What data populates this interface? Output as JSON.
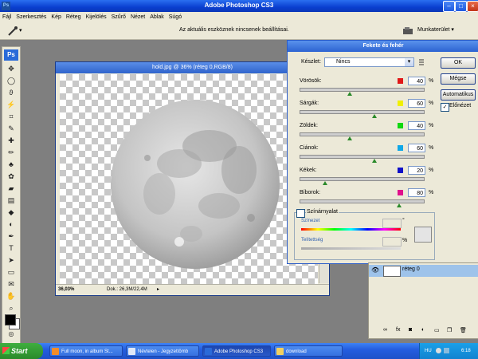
{
  "window": {
    "title": "Adobe Photoshop CS3",
    "minimize": "–",
    "maximize": "□",
    "close": "×"
  },
  "menu": [
    "Fájl",
    "Szerkesztés",
    "Kép",
    "Réteg",
    "Kijelölés",
    "Szűrő",
    "Nézet",
    "Ablak",
    "Súgó"
  ],
  "options": {
    "message": "Az aktuális eszköznek nincsenek beállításai.",
    "workspace_label": "Munkaterület ▾"
  },
  "toolbox": {
    "logo": "Ps"
  },
  "document": {
    "title": "hold.jpg @ 36% (réteg 0,RGB/8)",
    "zoom": "36,03%",
    "doc_info": "Dok.: 26,3M/22,4M"
  },
  "dialog": {
    "title": "Fekete és fehér",
    "preset_label": "Készlet:",
    "preset_value": "Nincs",
    "ok_label": "OK",
    "cancel_label": "Mégse",
    "auto_label": "Automatikus",
    "preview_label": "Előnézet",
    "preview_checked": true,
    "sliders": [
      {
        "label": "Vörösök:",
        "value": "40",
        "color": "#e01818",
        "level": 40
      },
      {
        "label": "Sárgák:",
        "value": "60",
        "color": "#f0f000",
        "level": 60
      },
      {
        "label": "Zöldek:",
        "value": "40",
        "color": "#10d810",
        "level": 40
      },
      {
        "label": "Ciánok:",
        "value": "60",
        "color": "#10a8e8",
        "level": 60
      },
      {
        "label": "Kékek:",
        "value": "20",
        "color": "#1010c8",
        "level": 20
      },
      {
        "label": "Bíborok:",
        "value": "80",
        "color": "#e0108c",
        "level": 80
      }
    ],
    "percent": "%",
    "tint_label": "Színárnyalat",
    "tint_checked": false,
    "hue_label": "Színezet",
    "hue_unit": "°",
    "saturation_label": "Telítettség",
    "saturation_unit": "%"
  },
  "layers": {
    "layer_name": "réteg 0"
  },
  "taskbar": {
    "start": "Start",
    "tasks": [
      {
        "label": "Full moon, in album St...",
        "active": false
      },
      {
        "label": "Névtelen - Jegyzettömb",
        "active": false
      },
      {
        "label": "Adobe Photoshop CS3",
        "active": true
      },
      {
        "label": "download",
        "active": false
      }
    ],
    "lang": "HU",
    "clock": "6:18"
  }
}
